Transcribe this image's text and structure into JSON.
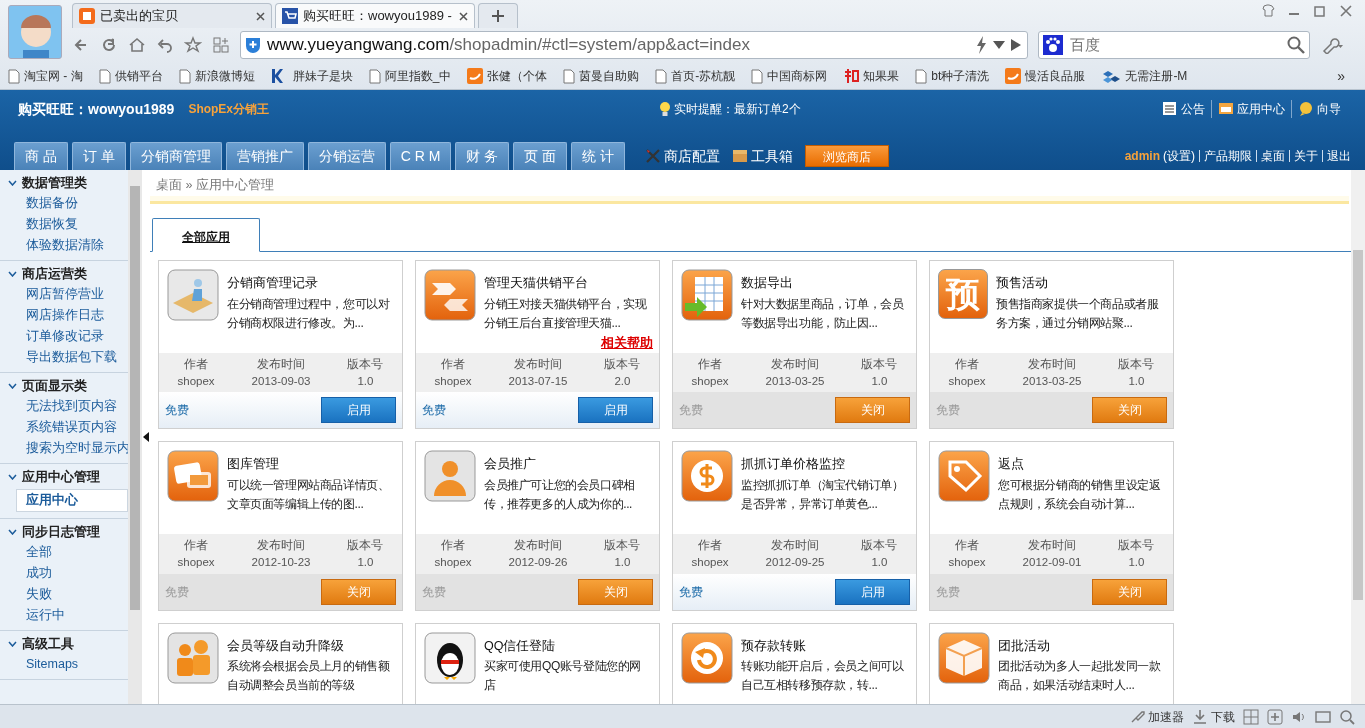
{
  "browser": {
    "tabs": [
      {
        "label": "已卖出的宝贝",
        "selected": false
      },
      {
        "label": "购买旺旺：wowyou1989 -",
        "selected": true
      }
    ],
    "url": {
      "domain": "www.yueyangwang.com",
      "path": "/shopadmin/#ctl=system/app&act=index"
    },
    "search": {
      "placeholder": "百度"
    },
    "bookmarks": [
      "淘宝网 - 淘",
      "供销平台",
      "新浪微博短",
      "胖妹子是块",
      "阿里指数_中",
      "张健（个体",
      "茵曼自助购",
      "首页-苏杭靓",
      "中国商标网",
      "知果果",
      "bt种子清洗",
      "慢活良品服",
      "无需注册-M"
    ],
    "bookmarks_more": "»"
  },
  "header": {
    "title": "购买旺旺：wowyou1989",
    "subtitle": "ShopEx分销王",
    "notice": "实时提醒：最新订单2个",
    "links": [
      "公告",
      "应用中心",
      "向导"
    ],
    "nav": [
      {
        "label": "商 品",
        "selected": false
      },
      {
        "label": "订 单",
        "selected": false
      },
      {
        "label": "分销商管理",
        "selected": false
      },
      {
        "label": "营销推广",
        "selected": false
      },
      {
        "label": "分销运营",
        "selected": false
      },
      {
        "label": "C R M",
        "selected": false
      },
      {
        "label": "财 务",
        "selected": false
      },
      {
        "label": "页 面",
        "selected": false
      },
      {
        "label": "统 计",
        "selected": false
      }
    ],
    "tools": [
      "商店配置",
      "工具箱"
    ],
    "browse_button": "浏览商店",
    "user": "admin",
    "user_settings": "(设置)",
    "user_links": [
      "产品期限",
      "桌面",
      "关于",
      "退出"
    ]
  },
  "sidebar": [
    {
      "title": "数据管理类",
      "items": [
        {
          "label": "数据备份",
          "selected": false
        },
        {
          "label": "数据恢复",
          "selected": false
        },
        {
          "label": "体验数据清除",
          "selected": false
        }
      ]
    },
    {
      "title": "商店运营类",
      "items": [
        {
          "label": "网店暂停营业",
          "selected": false
        },
        {
          "label": "网店操作日志",
          "selected": false
        },
        {
          "label": "订单修改记录",
          "selected": false
        },
        {
          "label": "导出数据包下载",
          "selected": false
        }
      ]
    },
    {
      "title": "页面显示类",
      "items": [
        {
          "label": "无法找到页内容",
          "selected": false
        },
        {
          "label": "系统错误页内容",
          "selected": false
        },
        {
          "label": "搜索为空时显示内",
          "selected": false
        }
      ]
    },
    {
      "title": "应用中心管理",
      "items": [
        {
          "label": "应用中心",
          "selected": true
        }
      ]
    },
    {
      "title": "同步日志管理",
      "items": [
        {
          "label": "全部",
          "selected": false
        },
        {
          "label": "成功",
          "selected": false
        },
        {
          "label": "失败",
          "selected": false
        },
        {
          "label": "运行中",
          "selected": false
        }
      ]
    },
    {
      "title": "高级工具",
      "items": [
        {
          "label": "Sitemaps",
          "selected": false
        }
      ]
    }
  ],
  "breadcrumb": "桌面 » 应用中心管理",
  "content_tabs": [
    {
      "label": "全部应用",
      "selected": true
    }
  ],
  "apps": [
    {
      "title": "分销商管理记录",
      "desc": "在分销商管理过程中，您可以对分销商权限进行修改。为...",
      "meta": [
        {
          "label": "作者",
          "value": "shopex"
        },
        {
          "label": "发布时间",
          "value": "2013-09-03"
        },
        {
          "label": "版本号",
          "value": "1.0"
        }
      ],
      "price": "免费",
      "button": "启用",
      "active": false
    },
    {
      "title": "管理天猫供销平台",
      "desc": "分销王对接天猫供销平台，实现分销王后台直接管理天猫...",
      "help_link": "相关帮助",
      "meta": [
        {
          "label": "作者",
          "value": "shopex"
        },
        {
          "label": "发布时间",
          "value": "2013-07-15"
        },
        {
          "label": "版本号",
          "value": "2.0"
        }
      ],
      "price": "免费",
      "button": "启用",
      "active": false
    },
    {
      "title": "数据导出",
      "desc": "针对大数据里商品，订单，会员等数据导出功能，防止因...",
      "meta": [
        {
          "label": "作者",
          "value": "shopex"
        },
        {
          "label": "发布时间",
          "value": "2013-03-25"
        },
        {
          "label": "版本号",
          "value": "1.0"
        }
      ],
      "price": "免费",
      "button": "关闭",
      "active": true
    },
    {
      "title": "预售活动",
      "icon_text": "预",
      "desc": "预售指商家提供一个商品或者服务方案，通过分销网站聚...",
      "meta": [
        {
          "label": "作者",
          "value": "shopex"
        },
        {
          "label": "发布时间",
          "value": "2013-03-25"
        },
        {
          "label": "版本号",
          "value": "1.0"
        }
      ],
      "price": "免费",
      "button": "关闭",
      "active": true
    },
    {
      "title": "图库管理",
      "desc": "可以统一管理网站商品详情页、文章页面等编辑上传的图...",
      "meta": [
        {
          "label": "作者",
          "value": "shopex"
        },
        {
          "label": "发布时间",
          "value": "2012-10-23"
        },
        {
          "label": "版本号",
          "value": "1.0"
        }
      ],
      "price": "免费",
      "button": "关闭",
      "active": true
    },
    {
      "title": "会员推广",
      "desc": "会员推广可让您的会员口碑相传，推荐更多的人成为你的...",
      "meta": [
        {
          "label": "作者",
          "value": "shopex"
        },
        {
          "label": "发布时间",
          "value": "2012-09-26"
        },
        {
          "label": "版本号",
          "value": "1.0"
        }
      ],
      "price": "免费",
      "button": "关闭",
      "active": true
    },
    {
      "title": "抓抓订单价格监控",
      "desc": "监控抓抓订单（淘宝代销订单）是否异常，异常订单黄色...",
      "meta": [
        {
          "label": "作者",
          "value": "shopex"
        },
        {
          "label": "发布时间",
          "value": "2012-09-25"
        },
        {
          "label": "版本号",
          "value": "1.0"
        }
      ],
      "price": "免费",
      "button": "启用",
      "active": false
    },
    {
      "title": "返点",
      "desc": "您可根据分销商的销售里设定返点规则，系统会自动计算...",
      "meta": [
        {
          "label": "作者",
          "value": "shopex"
        },
        {
          "label": "发布时间",
          "value": "2012-09-01"
        },
        {
          "label": "版本号",
          "value": "1.0"
        }
      ],
      "price": "免费",
      "button": "关闭",
      "active": true
    },
    {
      "title": "会员等级自动升降级",
      "desc": "系统将会根据会员上月的销售额自动调整会员当前的等级"
    },
    {
      "title": "QQ信任登陆",
      "desc": "买家可使用QQ账号登陆您的网店"
    },
    {
      "title": "预存款转账",
      "desc": "转账功能开启后，会员之间可以自己互相转移预存款，转..."
    },
    {
      "title": "团批活动",
      "desc": "团批活动为多人一起批发同一款商品，如果活动结束时人..."
    }
  ],
  "status_bar": [
    "加速器",
    "下载"
  ]
}
